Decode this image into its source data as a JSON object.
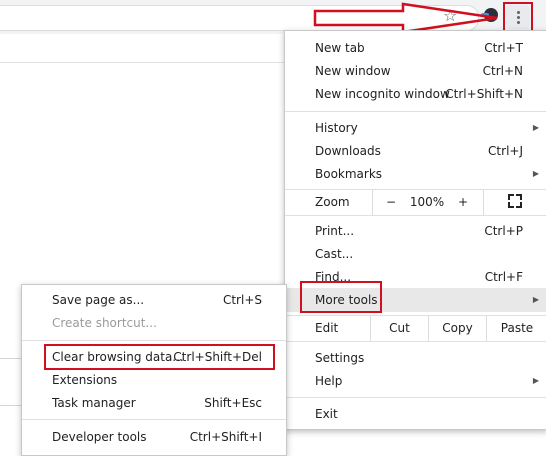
{
  "toolbar": {
    "star_icon": "star-icon",
    "extension_icon": "extension-icon",
    "menu_icon": "three-dots-vertical-icon"
  },
  "main_menu": {
    "items_top": [
      {
        "label": "New tab",
        "shortcut": "Ctrl+T"
      },
      {
        "label": "New window",
        "shortcut": "Ctrl+N"
      },
      {
        "label": "New incognito window",
        "shortcut": "Ctrl+Shift+N"
      }
    ],
    "items_mid": [
      {
        "label": "History",
        "shortcut": ""
      },
      {
        "label": "Downloads",
        "shortcut": "Ctrl+J"
      },
      {
        "label": "Bookmarks",
        "shortcut": ""
      }
    ],
    "zoom": {
      "label": "Zoom",
      "minus": "−",
      "value": "100%",
      "plus": "+"
    },
    "items_tools": [
      {
        "label": "Print...",
        "shortcut": "Ctrl+P"
      },
      {
        "label": "Cast...",
        "shortcut": ""
      },
      {
        "label": "Find...",
        "shortcut": "Ctrl+F"
      }
    ],
    "more_tools": {
      "label": "More tools"
    },
    "edit": {
      "label": "Edit",
      "cut": "Cut",
      "copy": "Copy",
      "paste": "Paste"
    },
    "items_settings": [
      {
        "label": "Settings"
      },
      {
        "label": "Help"
      }
    ],
    "exit": {
      "label": "Exit"
    }
  },
  "submenu": {
    "items_a": [
      {
        "label": "Save page as...",
        "shortcut": "Ctrl+S"
      },
      {
        "label": "Create shortcut...",
        "shortcut": ""
      }
    ],
    "items_b": [
      {
        "label": "Clear browsing data...",
        "shortcut": "Ctrl+Shift+Del"
      },
      {
        "label": "Extensions",
        "shortcut": ""
      },
      {
        "label": "Task manager",
        "shortcut": "Shift+Esc"
      }
    ],
    "items_c": [
      {
        "label": "Developer tools",
        "shortcut": "Ctrl+Shift+I"
      }
    ]
  },
  "colors": {
    "highlight": "#d0101f",
    "hover": "#e8e8e8"
  }
}
